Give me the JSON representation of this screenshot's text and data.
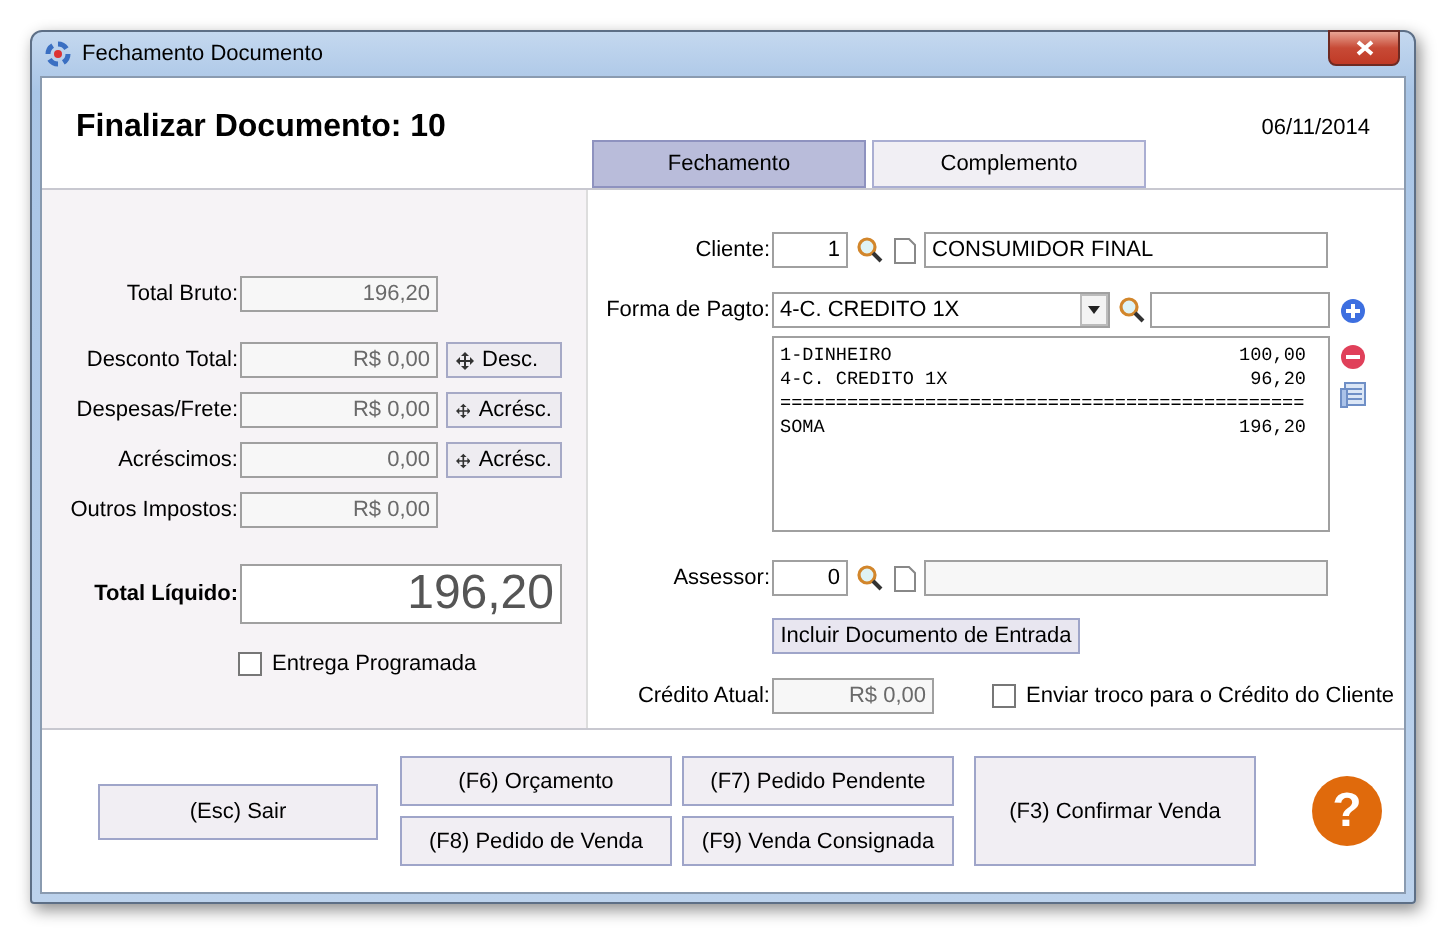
{
  "window": {
    "title": "Fechamento Documento"
  },
  "header": {
    "title": "Finalizar Documento: 10",
    "date": "06/11/2014"
  },
  "tabs": [
    {
      "label": "Fechamento",
      "selected": true
    },
    {
      "label": "Complemento",
      "selected": false
    }
  ],
  "totals": [
    {
      "label": "Total Bruto:",
      "value": "196,20",
      "disabled": true
    },
    {
      "label": "Desconto Total:",
      "value": "R$ 0,00",
      "button": "Desc.",
      "disabled": true
    },
    {
      "label": "Despesas/Frete:",
      "value": "R$ 0,00",
      "button": "Acrésc.",
      "disabled": true
    },
    {
      "label": "Acréscimos:",
      "value": "0,00",
      "button": "Acrésc.",
      "disabled": true
    },
    {
      "label": "Outros Impostos:",
      "value": "R$ 0,00",
      "disabled": true
    }
  ],
  "total_liquido": {
    "label": "Total Líquido:",
    "value": "196,20"
  },
  "entrega": {
    "label": "Entrega Programada",
    "checked": false
  },
  "cliente": {
    "label": "Cliente:",
    "code": "1",
    "name": "CONSUMIDOR FINAL"
  },
  "pagamento": {
    "label": "Forma de Pagto:",
    "selected": "4-C. CREDITO 1X"
  },
  "payments": [
    {
      "kind": "entry",
      "text": "1-DINHEIRO",
      "amount": "100,00"
    },
    {
      "kind": "entry",
      "text": "4-C. CREDITO 1X",
      "amount": "96,20"
    },
    {
      "kind": "separator",
      "text": "==============================================="
    },
    {
      "kind": "entry",
      "text": "SOMA",
      "amount": "196,20"
    }
  ],
  "assessor": {
    "label": "Assessor:",
    "code": "0"
  },
  "incluir_button": "Incluir Documento de Entrada",
  "credito": {
    "label": "Crédito Atual:",
    "value": "R$ 0,00",
    "disabled": true
  },
  "troco": {
    "label": "Enviar troco para o Crédito do Cliente",
    "checked": false
  },
  "exit_button": "(Esc) Sair",
  "action_buttons": [
    "(F6) Orçamento",
    "(F7) Pedido Pendente",
    "(F8) Pedido de Venda",
    "(F9) Venda Consignada"
  ],
  "confirm_button": "(F3) Confirmar Venda",
  "help": "?"
}
